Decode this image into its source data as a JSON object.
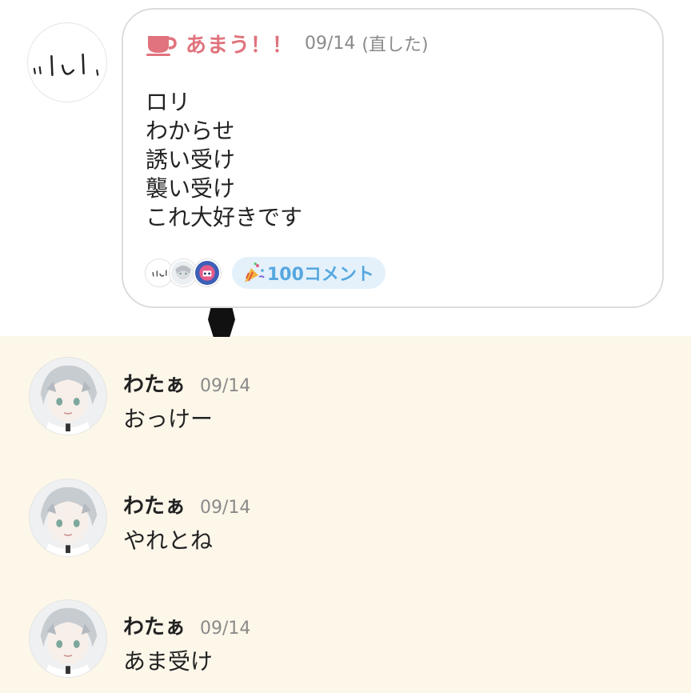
{
  "post": {
    "author": "あまう！！",
    "date": "09/14",
    "edited": "(直した)",
    "lines": [
      "ロリ",
      "わからせ",
      "誘い受け",
      "襲い受け",
      "これ大好きです"
    ],
    "badge": "100コメント",
    "icons": {
      "author_badge": "teacup-icon",
      "comment_badge": "party-popper-icon"
    }
  },
  "replies": [
    {
      "name": "わたぁ",
      "date": "09/14",
      "text": "おっけー"
    },
    {
      "name": "わたぁ",
      "date": "09/14",
      "text": "やれとね"
    },
    {
      "name": "わたぁ",
      "date": "09/14",
      "text": "あま受け"
    }
  ],
  "colors": {
    "author_accent": "#e0737d",
    "badge_bg": "#e4f1fb",
    "badge_text": "#56a7df",
    "reply_bg": "#fdf7ea"
  }
}
